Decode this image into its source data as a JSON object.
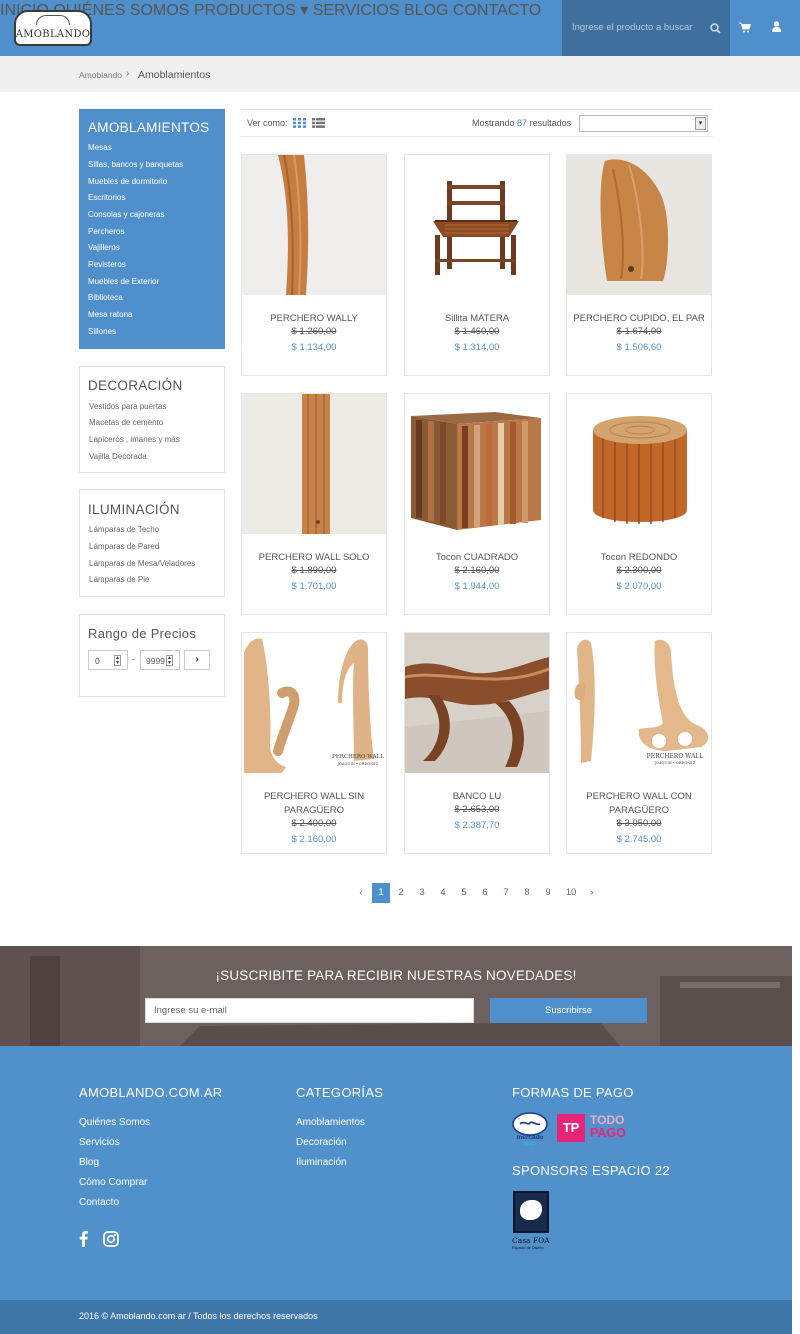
{
  "header": {
    "logo_text": "AMOBLANDO",
    "nav": [
      "INICIO",
      "QUIÉNES SOMOS",
      "PRODUCTOS ▾",
      "SERVICIOS",
      "BLOG",
      "CONTACTO"
    ],
    "search_placeholder": "Ingrese el producto a buscar",
    "icons": [
      "search-icon",
      "cart-icon",
      "user-icon"
    ]
  },
  "breadcrumb": {
    "home": "Amoblando",
    "current": "Amoblamientos"
  },
  "sidebar": {
    "amoblamientos": {
      "title": "AMOBLAMIENTOS",
      "items": [
        "Mesas",
        "Sillas, bancos y banquetas",
        "Muebles de dormitorio",
        "Escritorios",
        "Consolas y cajoneras",
        "Percheros",
        "Vajilleros",
        "Revisteros",
        "Muebles de Exterior",
        "Biblioteca",
        "Mesa ratona",
        "Sillones"
      ]
    },
    "decoracion": {
      "title": "DECORACIÓN",
      "items": [
        "Vestidos para puertas",
        "Macetas de cemento",
        "Lapiceros , imanes y más",
        "Vajilla Decorada"
      ]
    },
    "iluminacion": {
      "title": "ILUMINACIÓN",
      "items": [
        "Lámparas de Techo",
        "Lámparas de Pared",
        "Lámparas de Mesa/Veladores",
        "Lámparas de Pie"
      ]
    },
    "precios": {
      "title": "Rango de Precios",
      "min": "0",
      "dash": "-",
      "max": "9999"
    }
  },
  "toolbar": {
    "view_label": "Ver como:",
    "showing_prefix": "Mostrando",
    "count": "87",
    "showing_suffix": "resultados"
  },
  "products": [
    {
      "name": "PERCHERO WALLY",
      "old": "$ 1.260,00",
      "price": "$ 1.134,00"
    },
    {
      "name": "Sillita MATERA",
      "old": "$ 1.460,00",
      "price": "$ 1.314,00"
    },
    {
      "name": "PERCHERO CUPIDO, EL PAR",
      "old": "$ 1.674,00",
      "price": "$ 1.506,60"
    },
    {
      "name": "PERCHERO WALL SOLO",
      "old": "$ 1.890,00",
      "price": "$ 1.701,00"
    },
    {
      "name": "Tocon CUADRADO",
      "old": "$ 2.160,00",
      "price": "$ 1.944,00"
    },
    {
      "name": "Tocon REDONDO",
      "old": "$ 2.300,00",
      "price": "$ 2.070,00"
    },
    {
      "name": "PERCHERO WALL SIN PARAGÜERO",
      "old": "$ 2.400,00",
      "price": "$ 2.160,00"
    },
    {
      "name": "BANCO LU",
      "old": "$ 2.653,00",
      "price": "$ 2.387,70"
    },
    {
      "name": "PERCHERO WALL CON PARAGÜERO",
      "old": "$ 3.050,00",
      "price": "$ 2.745,00"
    }
  ],
  "image_texts": {
    "perchero_wall": "PERCHERO WALL",
    "designer": "JOAQUIN • ORDOÑEZ"
  },
  "pagination": {
    "prev": "‹",
    "pages": [
      "1",
      "2",
      "3",
      "4",
      "5",
      "6",
      "7",
      "8",
      "9",
      "10"
    ],
    "next": "›",
    "active": "1"
  },
  "newsletter": {
    "title": "¡SUSCRIBITE PARA RECIBIR NUESTRAS NOVEDADES!",
    "placeholder": "Ingrese su e-mail",
    "button": "Suscribirse"
  },
  "footer": {
    "col1": {
      "title": "AMOBLANDO.COM.AR",
      "links": [
        "Quiénes Somos",
        "Servicios",
        "Blog",
        "Cómo Comprar",
        "Contacto"
      ]
    },
    "col2": {
      "title": "CATEGORÍAS",
      "links": [
        "Amoblamientos",
        "Decoración",
        "Iluminación"
      ]
    },
    "col3": {
      "title": "FORMAS DE PAGO",
      "mercado": "mercado",
      "mercado2": "pago",
      "todo1": "TODO",
      "todo2": "PAGO",
      "tp": "TP"
    },
    "col4": {
      "title": "SPONSORS ESPACIO 22",
      "sponsor": "Casa FOA",
      "sponsor_sub": "Espacio de Diseño"
    },
    "social": [
      "facebook-icon",
      "instagram-icon"
    ],
    "copyright": "2016 © Amoblando.com.ar / Todos los derechos reservados"
  },
  "colors": {
    "accent": "#4f90cc",
    "search_bg": "#3f6f9c",
    "footer": "#5191cb",
    "copyright_bg": "#3f77ab",
    "wood": "#c17a3e"
  }
}
